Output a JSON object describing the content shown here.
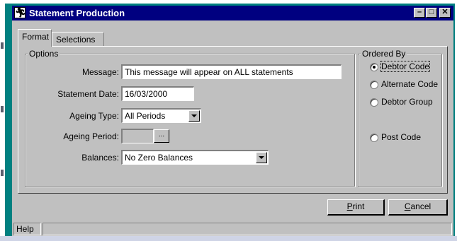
{
  "window": {
    "title": "Statement Production",
    "controls": [
      "minimize",
      "maximize",
      "close"
    ]
  },
  "tabs": [
    {
      "label": "Format",
      "active": true
    },
    {
      "label": "Selections",
      "active": false
    }
  ],
  "options": {
    "title": "Options",
    "message_label": "Message:",
    "message_value": "This message will appear on ALL statements",
    "statement_date_label": "Statement Date:",
    "statement_date_value": "16/03/2000",
    "ageing_type_label": "Ageing Type:",
    "ageing_type_value": "All Periods",
    "ageing_period_label": "Ageing Period:",
    "ageing_period_button": "...",
    "balances_label": "Balances:",
    "balances_value": "No Zero Balances"
  },
  "ordered_by": {
    "title": "Ordered By",
    "items": [
      {
        "label": "Debtor Code",
        "checked": true
      },
      {
        "label": "Alternate Code",
        "checked": false
      },
      {
        "label": "Debtor Group",
        "checked": false
      },
      {
        "label": "Post Code",
        "checked": false
      }
    ]
  },
  "buttons": {
    "print_label": "Print",
    "cancel_label": "Cancel"
  },
  "status": {
    "help_label": "Help"
  },
  "icons": {
    "app": "running-figure-icon"
  }
}
